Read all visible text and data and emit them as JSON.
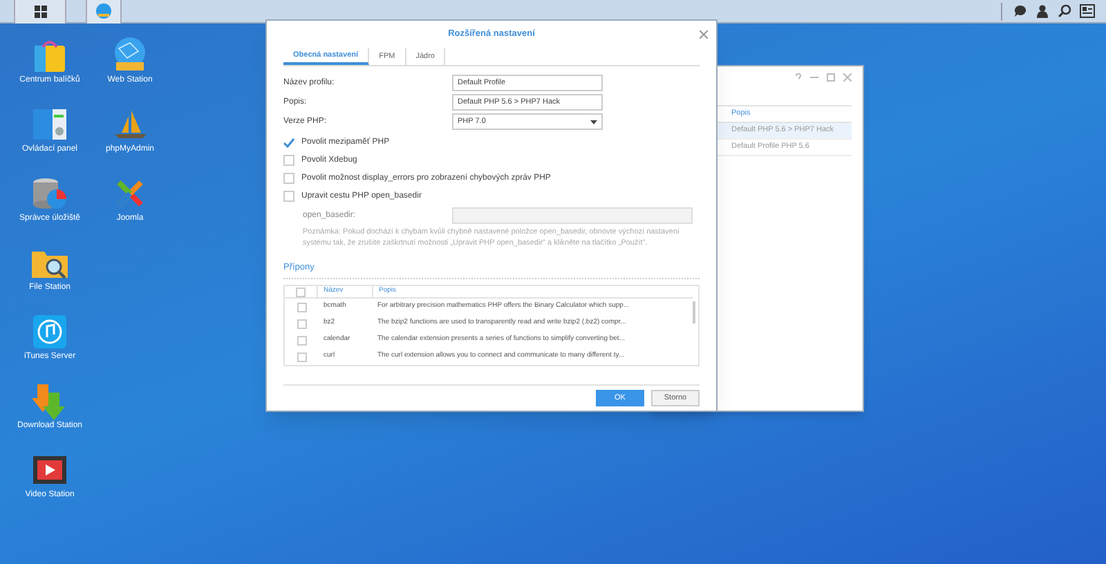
{
  "desktop": {
    "columns": [
      [
        {
          "label": "Centrum balíčků",
          "kind": "package"
        },
        {
          "label": "Ovládací panel",
          "kind": "panel"
        },
        {
          "label": "Správce úložiště",
          "kind": "storage"
        },
        {
          "label": "File Station",
          "kind": "folder"
        },
        {
          "label": "iTunes Server",
          "kind": "music"
        },
        {
          "label": "Download Station",
          "kind": "download"
        },
        {
          "label": "Video Station",
          "kind": "video"
        }
      ],
      [
        {
          "label": "Web Station",
          "kind": "www"
        },
        {
          "label": "phpMyAdmin",
          "kind": "sailboat"
        },
        {
          "label": "Joomla",
          "kind": "joomla"
        }
      ]
    ]
  },
  "background_window": {
    "column_header": "Popis",
    "rows": [
      {
        "text": "Default PHP 5.6 > PHP7 Hack",
        "selected": true
      },
      {
        "text": "Default Profile PHP 5.6",
        "selected": false
      }
    ]
  },
  "dialog": {
    "title": "Rozšířená nastavení",
    "tabs": [
      {
        "label": "Obecná nastavení",
        "selected": true
      },
      {
        "label": "FPM",
        "selected": false
      },
      {
        "label": "Jádro",
        "selected": false
      }
    ],
    "fields": [
      {
        "label": "Název profilu:",
        "value": "Default Profile",
        "kind": "text"
      },
      {
        "label": "Popis:",
        "value": "Default PHP 5.6 > PHP7 Hack",
        "kind": "text"
      },
      {
        "label": "Verze PHP:",
        "value": "PHP 7.0",
        "kind": "select"
      }
    ],
    "checkboxes": [
      {
        "label": "Povolit mezipaměť PHP",
        "checked": true
      },
      {
        "label": "Povolit Xdebug",
        "checked": false
      },
      {
        "label": "Povolit možnost display_errors pro zobrazení chybových zpráv PHP",
        "checked": false
      },
      {
        "label": "Upravit cestu PHP open_basedir",
        "checked": false
      }
    ],
    "open_basedir": {
      "label": "open_basedir:",
      "disabled": true
    },
    "note": "Poznámka: Pokud dochází k chybám kvůli chybně nastavené položce open_basedir, obnovte výchozí nastavení systému tak, že zrušíte zaškrtnutí možnosti „Upravit PHP open_basedir\" a klikněte na tlačítko „Použít\".",
    "extensions": {
      "title": "Přípony",
      "select_all_checked": false,
      "columns": [
        "Název",
        "Popis"
      ],
      "rows": [
        {
          "name": "bcmath",
          "description": "For arbitrary precision mathematics PHP offers the Binary Calculator which supp...",
          "checked": false
        },
        {
          "name": "bz2",
          "description": "The bzip2 functions are used to transparently read and write bzip2 (.bz2) compr...",
          "checked": false
        },
        {
          "name": "calendar",
          "description": "The calendar extension presents a series of functions to simplify converting bet...",
          "checked": false
        },
        {
          "name": "curl",
          "description": "The curl extension allows you to connect and communicate to many different ty...",
          "checked": false
        }
      ]
    },
    "buttons": [
      {
        "label": "OK",
        "kind": "primary"
      },
      {
        "label": "Storno",
        "kind": "secondary"
      }
    ]
  }
}
